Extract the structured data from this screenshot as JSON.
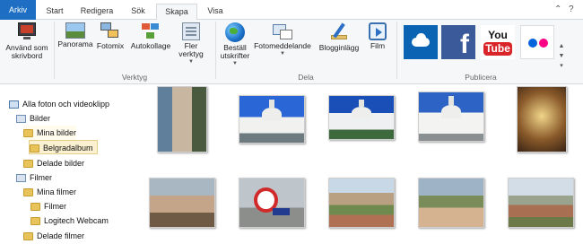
{
  "tabs": {
    "file": "Arkiv",
    "items": [
      "Start",
      "Redigera",
      "Sök",
      "Skapa",
      "Visa"
    ],
    "active": "Skapa"
  },
  "ribbon": {
    "groups": {
      "first_button": "Använd som skrivbord",
      "verktyg": {
        "label": "Verktyg",
        "buttons": [
          "Panorama",
          "Fotomix",
          "Autokollage",
          "Fler verktyg"
        ]
      },
      "dela": {
        "label": "Dela",
        "buttons": [
          "Beställ utskrifter",
          "Fotomeddelande",
          "Blogginlägg",
          "Film"
        ]
      },
      "publicera": {
        "label": "Publicera",
        "services": [
          "onedrive-icon",
          "facebook-icon",
          "youtube-icon",
          "flickr-icon"
        ],
        "youtube_text": "You",
        "youtube_tube": "Tube",
        "facebook_text": "f"
      }
    }
  },
  "sidebar": {
    "items": [
      {
        "label": "Alla foton och videoklipp",
        "level": 0
      },
      {
        "label": "Bilder",
        "level": 1
      },
      {
        "label": "Mina bilder",
        "level": 2
      },
      {
        "label": "Belgradalbum",
        "level": 3
      },
      {
        "label": "Delade bilder",
        "level": 2
      },
      {
        "label": "Filmer",
        "level": 1
      },
      {
        "label": "Mina filmer",
        "level": 2
      },
      {
        "label": "Filmer",
        "level": 3
      },
      {
        "label": "Logitech Webcam",
        "level": 3
      },
      {
        "label": "Delade filmer",
        "level": 2
      }
    ]
  },
  "photos": {
    "row1": [
      "cafe-portrait",
      "temple-1",
      "temple-2",
      "temple-3",
      "temple-interior"
    ],
    "row2": [
      "cafe-friends",
      "street-sign",
      "city-rooftops",
      "couple-selfie",
      "city-view"
    ]
  }
}
